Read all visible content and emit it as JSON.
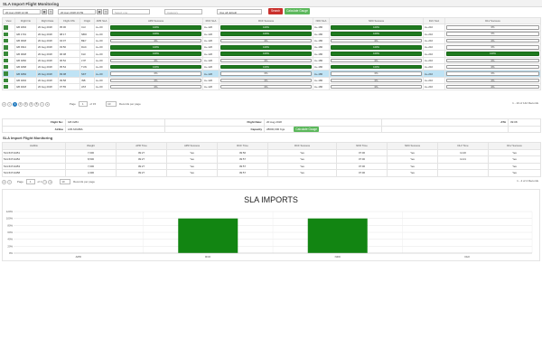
{
  "title": "SLA Import Flight Monitoring",
  "toolbar": {
    "from_date": "20 Aug 2018 12:00",
    "to_date": "20 Aug 2018 23:59",
    "airline_placeholder": "Select one",
    "category_placeholder": "Category",
    "station": "Use all default",
    "search_label": "Search",
    "calc_label": "Calculate Gauge"
  },
  "grid1": {
    "columns": [
      "View",
      "Flight No",
      "Flight Date",
      "Flight ATA",
      "Origin",
      "APR SLA",
      "APR Success",
      "RCF SLA",
      "RCF Success",
      "NFD SLA",
      "NFD Success",
      "DLV SLA",
      "DLV Success"
    ],
    "rows": [
      {
        "flight": "GB 1804",
        "date": "20 Aug 2018",
        "ata": "05:00",
        "origin": "CAI",
        "apr": "A+-60",
        "apr_s": "100%",
        "rcf": "A+-120",
        "rcf_s": "100%",
        "nfd": "A+-180",
        "nfd_s": "100%",
        "dlv": "A+-210",
        "dlv_s": "0%"
      },
      {
        "flight": "GB 1701",
        "date": "20 Aug 2018",
        "ata": "08:17",
        "origin": "NBO",
        "apr": "A+-60",
        "apr_s": "100%",
        "rcf": "A+-120",
        "rcf_s": "100%",
        "nfd": "A+-180",
        "nfd_s": "100%",
        "dlv": "A+-210",
        "dlv_s": "0%"
      },
      {
        "flight": "GB 0048",
        "date": "20 Aug 2018",
        "ata": "04:07",
        "origin": "BEY",
        "apr": "A+-60",
        "apr_s": "0%",
        "rcf": "A+-120",
        "rcf_s": "0%",
        "nfd": "A+-180",
        "nfd_s": "0%",
        "dlv": "A+-210",
        "dlv_s": "0%"
      },
      {
        "flight": "GB 0312",
        "date": "20 Aug 2018",
        "ata": "03:50",
        "origin": "DAC",
        "apr": "A+-60",
        "apr_s": "100%",
        "rcf": "A+-120",
        "rcf_s": "100%",
        "nfd": "A+-180",
        "nfd_s": "100%",
        "dlv": "A+-210",
        "dlv_s": "0%"
      },
      {
        "flight": "GB 0048",
        "date": "20 Aug 2018",
        "ata": "06:08",
        "origin": "KHI",
        "apr": "A+-60",
        "apr_s": "100%",
        "rcf": "A+-120",
        "rcf_s": "100%",
        "nfd": "A+-180",
        "nfd_s": "100%",
        "dlv": "A+-210",
        "dlv_s": "100%"
      },
      {
        "flight": "GB 0260",
        "date": "20 Aug 2018",
        "ata": "06:52",
        "origin": "LYP",
        "apr": "A+-60",
        "apr_s": "0%",
        "rcf": "A+-120",
        "rcf_s": "0%",
        "nfd": "A+-180",
        "nfd_s": "0%",
        "dlv": "A+-210",
        "dlv_s": "0%"
      },
      {
        "flight": "GB 0268",
        "date": "20 Aug 2018",
        "ata": "05:54",
        "origin": "TUN",
        "apr": "A+-60",
        "apr_s": "100%",
        "rcf": "A+-120",
        "rcf_s": "100%",
        "nfd": "A+-180",
        "nfd_s": "100%",
        "dlv": "A+-210",
        "dlv_s": "0%"
      },
      {
        "flight": "GB 0284",
        "date": "20 Aug 2018",
        "ata": "09:08",
        "origin": "SKT",
        "apr": "A+-60",
        "apr_s": "0%",
        "rcf": "A+-120",
        "rcf_s": "0%",
        "nfd": "A+-180",
        "nfd_s": "0%",
        "dlv": "A+-210",
        "dlv_s": "0%"
      },
      {
        "flight": "GB 0294",
        "date": "20 Aug 2018",
        "ata": "09:58",
        "origin": "ISB",
        "apr": "A+-60",
        "apr_s": "0%",
        "rcf": "A+-120",
        "rcf_s": "0%",
        "nfd": "A+-180",
        "nfd_s": "0%",
        "dlv": "A+-210",
        "dlv_s": "0%"
      },
      {
        "flight": "GB 4018",
        "date": "20 Aug 2018",
        "ata": "07:55",
        "origin": "ATZ",
        "apr": "A+-60",
        "apr_s": "0%",
        "rcf": "A+-120",
        "rcf_s": "0%",
        "nfd": "A+-180",
        "nfd_s": "0%",
        "dlv": "A+-210",
        "dlv_s": "0%"
      }
    ],
    "selected_row": 7
  },
  "pager1": {
    "page_label": "Page",
    "page_value": "1",
    "of_label": "of 15",
    "pages": [
      "1",
      "2",
      "3",
      "4",
      "5"
    ],
    "per_page": "10",
    "per_page_label": "Records per page",
    "summary": "1 - 10 of 142 Records"
  },
  "info": {
    "flight_no_label": "Flight No:",
    "flight_no": "GB 0284",
    "airline_label": "Airline",
    "airline": "AIR ARABIA",
    "flight_date_label": "Flight Date:",
    "flight_date": "20 Aug 2018",
    "capacity_label": "Capacity",
    "capacity": "28000,000 Kgs",
    "ata_label": "ATA",
    "ata": "09:08",
    "calc_label": "Calculate Gauge"
  },
  "grid2": {
    "title": "SLA Import Flight Monitoring",
    "columns": [
      "AwbNo",
      "Weight",
      "APR Time",
      "APR Success",
      "RCF Time",
      "RCF Success",
      "NFD Time",
      "NFD Success",
      "DLV Time",
      "DLV Success"
    ],
    "rows": [
      {
        "awb": "514-54714451",
        "weight": "7,000",
        "apr_t": "09:27",
        "apr_s": "Yes",
        "rcf_t": "09:56",
        "rcf_s": "Yes",
        "nfd_t": "07:00",
        "nfd_s": "Yes",
        "dlv_t": "11:20",
        "dlv_s": "Yes"
      },
      {
        "awb": "514-54714452",
        "weight": "8,500",
        "apr_t": "09:27",
        "apr_s": "Yes",
        "rcf_t": "09:57",
        "rcf_s": "Yes",
        "nfd_t": "07:00",
        "nfd_s": "Yes",
        "dlv_t": "11:21",
        "dlv_s": "Yes"
      },
      {
        "awb": "514-54714453",
        "weight": "7,000",
        "apr_t": "09:27",
        "apr_s": "Yes",
        "rcf_t": "09:57",
        "rcf_s": "Yes",
        "nfd_t": "07:00",
        "nfd_s": "Yes",
        "dlv_t": "",
        "dlv_s": "Yes"
      },
      {
        "awb": "514-54714458",
        "weight": "4,300",
        "apr_t": "09:27",
        "apr_s": "Yes",
        "rcf_t": "09:57",
        "rcf_s": "Yes",
        "nfd_t": "07:00",
        "nfd_s": "Yes",
        "dlv_t": "",
        "dlv_s": "Yes"
      }
    ]
  },
  "pager2": {
    "page_label": "Page",
    "page_value": "1",
    "of_label": "of 1",
    "per_page": "10",
    "per_page_label": "Records per page",
    "summary": "1 - 4 of 4 Records"
  },
  "chart_data": {
    "type": "bar",
    "title": "SLA IMPORTS",
    "categories": [
      "APR",
      "RCF",
      "NFD",
      "DLV"
    ],
    "values": [
      0,
      100,
      100,
      0
    ],
    "ylim": [
      0,
      120
    ],
    "yticks": [
      "0%",
      "20%",
      "40%",
      "60%",
      "80%",
      "100%",
      "120%"
    ],
    "xlabel": "",
    "ylabel": "",
    "grid": true,
    "bar_color": "#128512"
  }
}
